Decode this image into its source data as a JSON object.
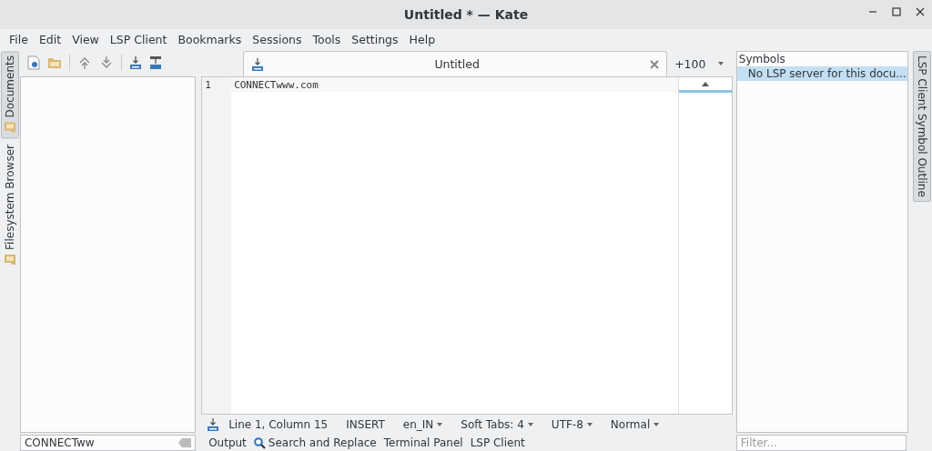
{
  "window": {
    "title": "Untitled * — Kate"
  },
  "menu": [
    {
      "label": "File"
    },
    {
      "label": "Edit"
    },
    {
      "label": "View"
    },
    {
      "label": "LSP Client"
    },
    {
      "label": "Bookmarks"
    },
    {
      "label": "Sessions"
    },
    {
      "label": "Tools"
    },
    {
      "label": "Settings"
    },
    {
      "label": "Help"
    }
  ],
  "left_sidebar_tabs": [
    {
      "label": "Documents",
      "selected": true
    },
    {
      "label": "Filesystem Browser",
      "selected": false
    }
  ],
  "documents_panel": {
    "filter": {
      "value": "CONNECTww"
    }
  },
  "editor": {
    "tabs": [
      {
        "label": "Untitled",
        "selected": true
      }
    ],
    "tab_overflow": "+100",
    "lines": [
      {
        "number": "1",
        "text": "CONNECTwww.com"
      }
    ]
  },
  "status_bar": {
    "position": "Line 1, Column 15",
    "mode": "INSERT",
    "dropdowns": [
      {
        "label": "en_IN"
      },
      {
        "label": "Soft Tabs: 4"
      },
      {
        "label": "UTF-8"
      },
      {
        "label": "Normal"
      }
    ]
  },
  "bottom_tabs": [
    {
      "label": "Output",
      "kind": "plain"
    },
    {
      "label": "Search and Replace",
      "kind": "search"
    },
    {
      "label": "Terminal Panel",
      "kind": "plain"
    },
    {
      "label": "LSP Client",
      "kind": "plain"
    }
  ],
  "symbols_panel": {
    "header": "Symbols",
    "items": [
      {
        "label": "No LSP server for this docu...",
        "selected": true
      }
    ],
    "filter": {
      "placeholder": "Filter..."
    }
  },
  "right_sidebar_tabs": [
    {
      "label": "LSP Client Symbol Outline",
      "selected": true
    }
  ]
}
